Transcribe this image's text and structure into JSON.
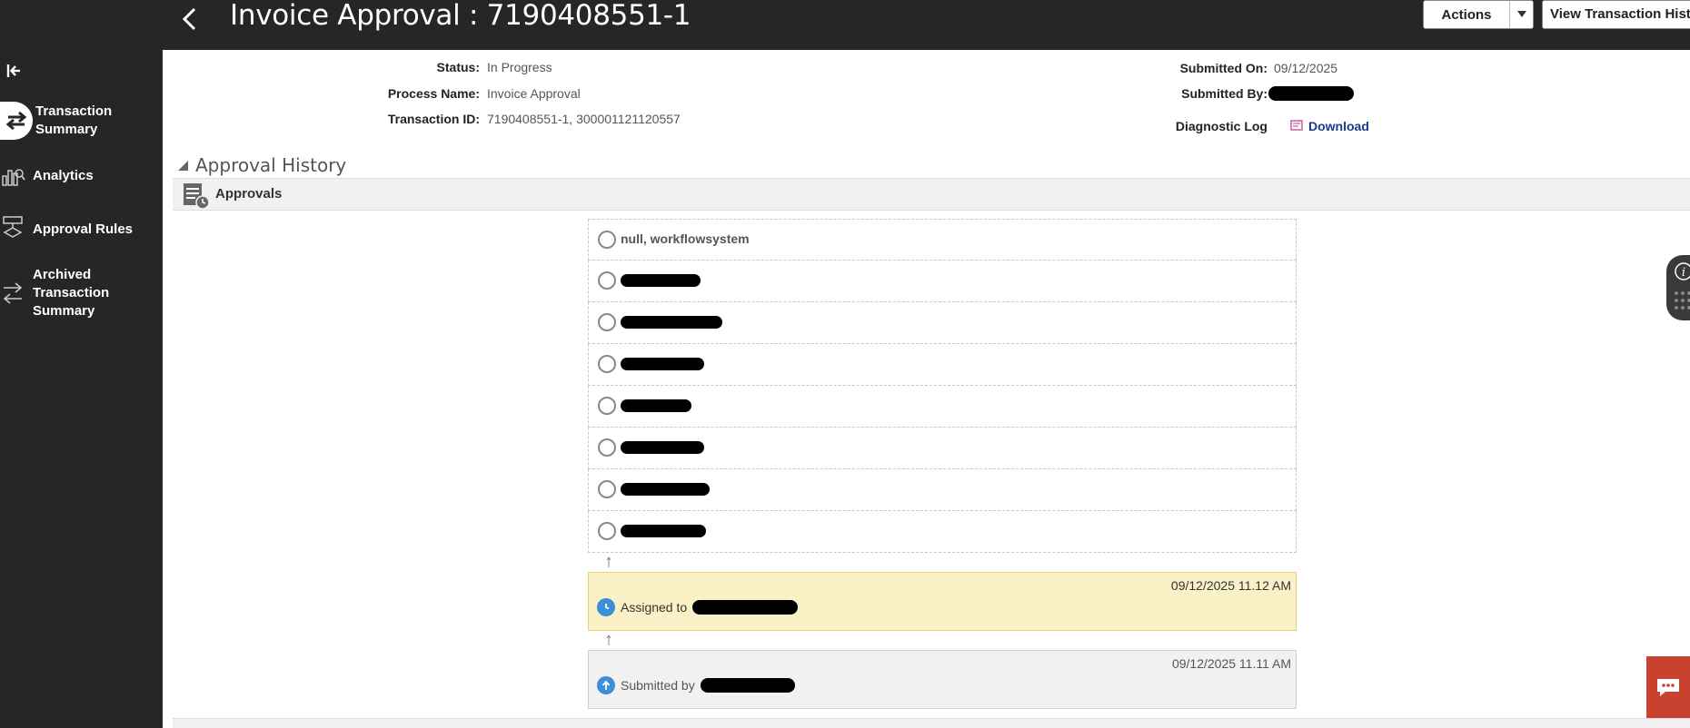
{
  "header": {
    "title": "Invoice Approval : 7190408551-1",
    "actions_label": "Actions",
    "view_history_label": "View Transaction History"
  },
  "sidebar": {
    "items": [
      {
        "label": "Transaction Summary",
        "icon": "swap-arrows-icon",
        "active": true
      },
      {
        "label": "Analytics",
        "icon": "analytics-chart-icon",
        "active": false
      },
      {
        "label": "Approval Rules",
        "icon": "approval-rules-icon",
        "active": false
      },
      {
        "label": "Archived Transaction Summary",
        "icon": "archived-swap-icon",
        "active": false
      }
    ]
  },
  "details": {
    "status_label": "Status:",
    "status_value": "In Progress",
    "process_label": "Process Name:",
    "process_value": "Invoice Approval",
    "txn_label": "Transaction ID:",
    "txn_value": "7190408551-1, 300001121120557",
    "submitted_on_label": "Submitted On:",
    "submitted_on_value": "09/12/2025",
    "submitted_by_label": "Submitted By:",
    "diag_label": "Diagnostic Log",
    "download_label": "Download"
  },
  "approval_history": {
    "title": "Approval History",
    "approvals_label": "Approvals",
    "approvers": [
      "null, workflowsystem"
    ],
    "assigned": {
      "time": "09/12/2025 11.12 AM",
      "text": "Assigned to"
    },
    "submitted": {
      "time": "09/12/2025 11.11 AM",
      "text": "Submitted by"
    }
  },
  "colors": {
    "topbar": "#262626",
    "assigned_bg": "#fbf1c6",
    "accent_blue": "#3c8fd6",
    "chat": "#c9412f"
  }
}
